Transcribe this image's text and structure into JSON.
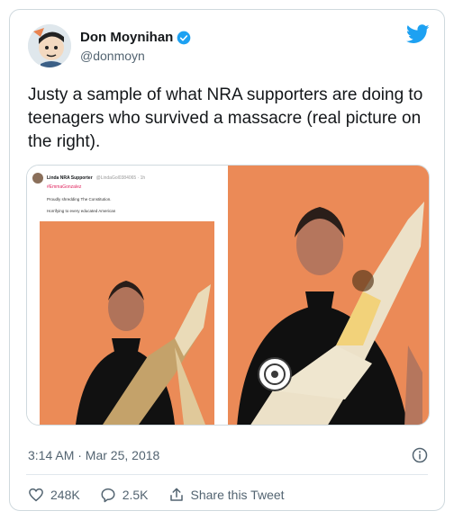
{
  "author": {
    "name": "Don Moynihan",
    "handle": "@donmoyn"
  },
  "tweet": {
    "text": "Justy a sample of what NRA supporters are doing to teenagers who survived a massacre (real picture on the right).",
    "timestamp": "3:14 AM · Mar 25, 2018"
  },
  "embedded_tweet": {
    "name": "Linda NRA Supporter",
    "handle": "@LindaGol0384065 · 1h",
    "reply_to": "#EmmaGonzalez",
    "line1": "Proudly shredding The Constitution.",
    "line2": "Horrifying to every educated American"
  },
  "actions": {
    "likes": "248K",
    "replies": "2.5K",
    "share_label": "Share this Tweet"
  },
  "colors": {
    "twitter_blue": "#1da1f2",
    "text_secondary": "#536471",
    "photo_orange": "#e9834f"
  },
  "icons": [
    "verified-badge-icon",
    "twitter-bird-icon",
    "info-icon",
    "heart-icon",
    "reply-icon",
    "share-icon"
  ]
}
